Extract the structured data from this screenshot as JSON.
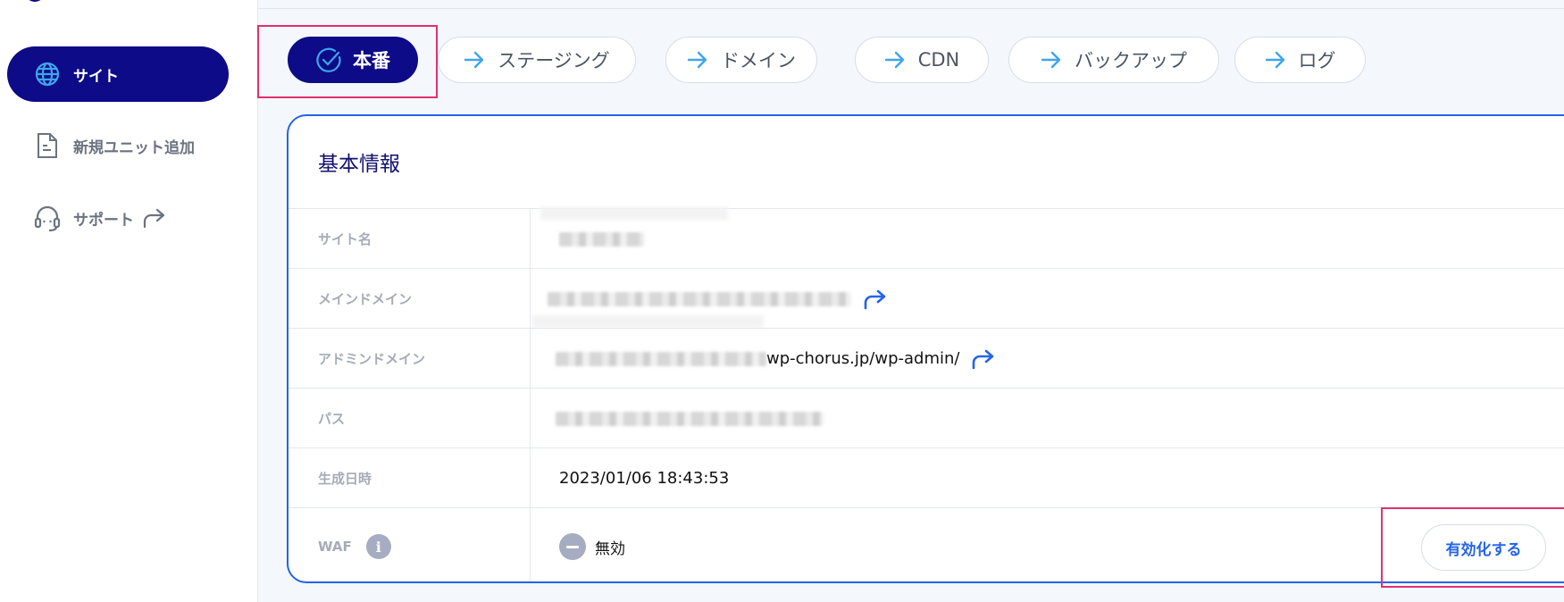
{
  "sidebar": {
    "items": [
      {
        "label": "サイト",
        "icon": "globe-icon",
        "active": true
      },
      {
        "label": "新規ユニット追加",
        "icon": "document-icon",
        "active": false
      },
      {
        "label": "サポート",
        "icon": "headset-icon",
        "active": false,
        "external": true
      }
    ]
  },
  "tabs": [
    {
      "label": "本番",
      "icon": "check-circle-icon",
      "active": true
    },
    {
      "label": "ステージング",
      "icon": "arrow-right-icon"
    },
    {
      "label": "ドメイン",
      "icon": "arrow-right-icon"
    },
    {
      "label": "CDN",
      "icon": "arrow-right-icon"
    },
    {
      "label": "バックアップ",
      "icon": "arrow-right-icon"
    },
    {
      "label": "ログ",
      "icon": "arrow-right-icon"
    }
  ],
  "card": {
    "title": "基本情報",
    "rows": [
      {
        "label": "サイト名",
        "value": ""
      },
      {
        "label": "メインドメイン",
        "value": ""
      },
      {
        "label": "アドミンドメイン",
        "value": "wp-chorus.jp/wp-admin/"
      },
      {
        "label": "パス",
        "value": ""
      },
      {
        "label": "生成日時",
        "value": "2023/01/06 18:43:53"
      },
      {
        "label": "WAF",
        "value": "無効"
      }
    ],
    "waf_info_icon": "i",
    "enable_button": "有効化する"
  },
  "colors": {
    "brand_navy": "#0d0b87",
    "accent_blue": "#2563eb",
    "highlight": "#e0306f",
    "arrow_blue": "#3ea6ea"
  }
}
